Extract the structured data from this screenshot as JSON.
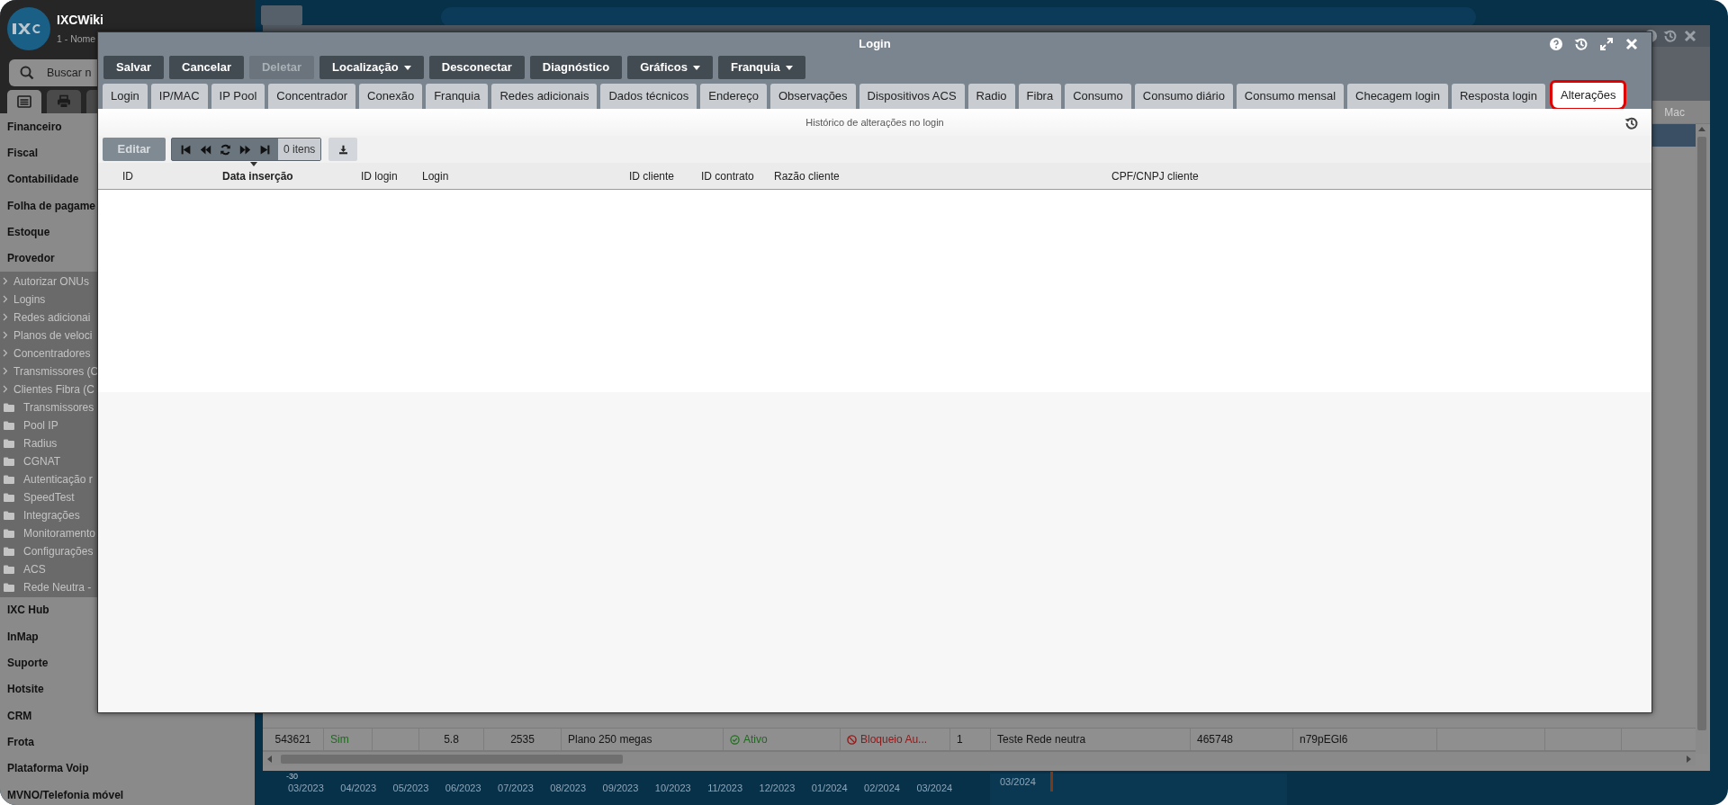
{
  "sidebar": {
    "app_name": "IXCWiki",
    "subtitle": "1 - Nome",
    "search": {
      "placeholder": "Buscar n"
    },
    "view_tabs": [
      {
        "kind": "list",
        "selected": true
      },
      {
        "kind": "print",
        "selected": false
      },
      {
        "kind": "blank",
        "selected": false
      }
    ],
    "menu": [
      {
        "label": "Financeiro",
        "kind": "section"
      },
      {
        "label": "Fiscal",
        "kind": "section"
      },
      {
        "label": "Contabilidade",
        "kind": "section"
      },
      {
        "label": "Folha de pagame",
        "kind": "section"
      },
      {
        "label": "Estoque",
        "kind": "section"
      },
      {
        "label": "Provedor",
        "kind": "section"
      },
      {
        "label": "Autorizar ONUs",
        "kind": "link"
      },
      {
        "label": "Logins",
        "kind": "link"
      },
      {
        "label": "Redes adicionai",
        "kind": "link"
      },
      {
        "label": "Planos de veloci",
        "kind": "link"
      },
      {
        "label": "Concentradores",
        "kind": "link"
      },
      {
        "label": "Transmissores (C",
        "kind": "link"
      },
      {
        "label": "Clientes Fibra (C",
        "kind": "link"
      },
      {
        "label": "Transmissores",
        "kind": "folder"
      },
      {
        "label": "Pool IP",
        "kind": "folder"
      },
      {
        "label": "Radius",
        "kind": "folder"
      },
      {
        "label": "CGNAT",
        "kind": "folder"
      },
      {
        "label": "Autenticação r",
        "kind": "folder"
      },
      {
        "label": "SpeedTest",
        "kind": "folder"
      },
      {
        "label": "Integrações",
        "kind": "folder"
      },
      {
        "label": "Monitoramento",
        "kind": "folder"
      },
      {
        "label": "Configurações",
        "kind": "folder"
      },
      {
        "label": "ACS",
        "kind": "folder"
      },
      {
        "label": "Rede Neutra -",
        "kind": "folder"
      },
      {
        "label": "IXC Hub",
        "kind": "section"
      },
      {
        "label": "InMap",
        "kind": "section"
      },
      {
        "label": "Suporte",
        "kind": "section"
      },
      {
        "label": "Hotsite",
        "kind": "section"
      },
      {
        "label": "CRM",
        "kind": "section"
      },
      {
        "label": "Frota",
        "kind": "section"
      },
      {
        "label": "Plataforma Voip",
        "kind": "section"
      },
      {
        "label": "MVNO/Telefonia móvel",
        "kind": "section"
      }
    ]
  },
  "background_window": {
    "column_label": "Mac",
    "row": [
      {
        "kind": "text",
        "text": "543621"
      },
      {
        "kind": "yes",
        "text": "Sim"
      },
      {
        "kind": "empty"
      },
      {
        "kind": "number",
        "text": "5.8"
      },
      {
        "kind": "number",
        "text": "2535"
      },
      {
        "kind": "text",
        "text": "Plano 250 megas"
      },
      {
        "kind": "ok",
        "text": "Ativo"
      },
      {
        "kind": "blocked",
        "text": "Bloqueio Au..."
      },
      {
        "kind": "text",
        "text": "1"
      },
      {
        "kind": "text",
        "text": "Teste Rede neutra"
      },
      {
        "kind": "text",
        "text": "465748"
      },
      {
        "kind": "text",
        "text": "n79pEGl6"
      },
      {
        "kind": "empty"
      },
      {
        "kind": "empty"
      }
    ]
  },
  "background_chart": {
    "axis_label": "-30",
    "months": [
      "03/2023",
      "04/2023",
      "05/2023",
      "06/2023",
      "07/2023",
      "08/2023",
      "09/2023",
      "10/2023",
      "11/2023",
      "12/2023",
      "01/2024",
      "02/2024",
      "03/2024"
    ],
    "second_label": "03/2024"
  },
  "modal": {
    "title": "Login",
    "actions": [
      {
        "label": "Salvar",
        "disabled": false,
        "dropdown": false
      },
      {
        "label": "Cancelar",
        "disabled": false,
        "dropdown": false
      },
      {
        "label": "Deletar",
        "disabled": true,
        "dropdown": false
      },
      {
        "label": "Localização",
        "disabled": false,
        "dropdown": true
      },
      {
        "label": "Desconectar",
        "disabled": false,
        "dropdown": false
      },
      {
        "label": "Diagnóstico",
        "disabled": false,
        "dropdown": false
      },
      {
        "label": "Gráficos",
        "disabled": false,
        "dropdown": true
      },
      {
        "label": "Franquia",
        "disabled": false,
        "dropdown": true
      }
    ],
    "tabs": [
      {
        "label": "Login",
        "selected": false
      },
      {
        "label": "IP/MAC",
        "selected": false
      },
      {
        "label": "IP Pool",
        "selected": false
      },
      {
        "label": "Concentrador",
        "selected": false
      },
      {
        "label": "Conexão",
        "selected": false
      },
      {
        "label": "Franquia",
        "selected": false
      },
      {
        "label": "Redes adicionais",
        "selected": false
      },
      {
        "label": "Dados técnicos",
        "selected": false
      },
      {
        "label": "Endereço",
        "selected": false
      },
      {
        "label": "Observações",
        "selected": false
      },
      {
        "label": "Dispositivos ACS",
        "selected": false
      },
      {
        "label": "Radio",
        "selected": false
      },
      {
        "label": "Fibra",
        "selected": false
      },
      {
        "label": "Consumo",
        "selected": false
      },
      {
        "label": "Consumo diário",
        "selected": false
      },
      {
        "label": "Consumo mensal",
        "selected": false
      },
      {
        "label": "Checagem login",
        "selected": false
      },
      {
        "label": "Resposta login",
        "selected": false
      },
      {
        "label": "Alterações",
        "selected": true
      }
    ],
    "caption": "Histórico de alterações no login",
    "edit_button": {
      "label": "Editar",
      "disabled": true
    },
    "item_count": "0 itens",
    "columns": [
      {
        "label": "ID",
        "sorted": false
      },
      {
        "label": "Data inserção",
        "sorted": true
      },
      {
        "label": "ID login",
        "sorted": false
      },
      {
        "label": "Login",
        "sorted": false
      },
      {
        "label": "ID cliente",
        "sorted": false
      },
      {
        "label": "ID contrato",
        "sorted": false
      },
      {
        "label": "Razão cliente",
        "sorted": false
      },
      {
        "label": "CPF/CNPJ cliente",
        "sorted": false
      }
    ]
  }
}
